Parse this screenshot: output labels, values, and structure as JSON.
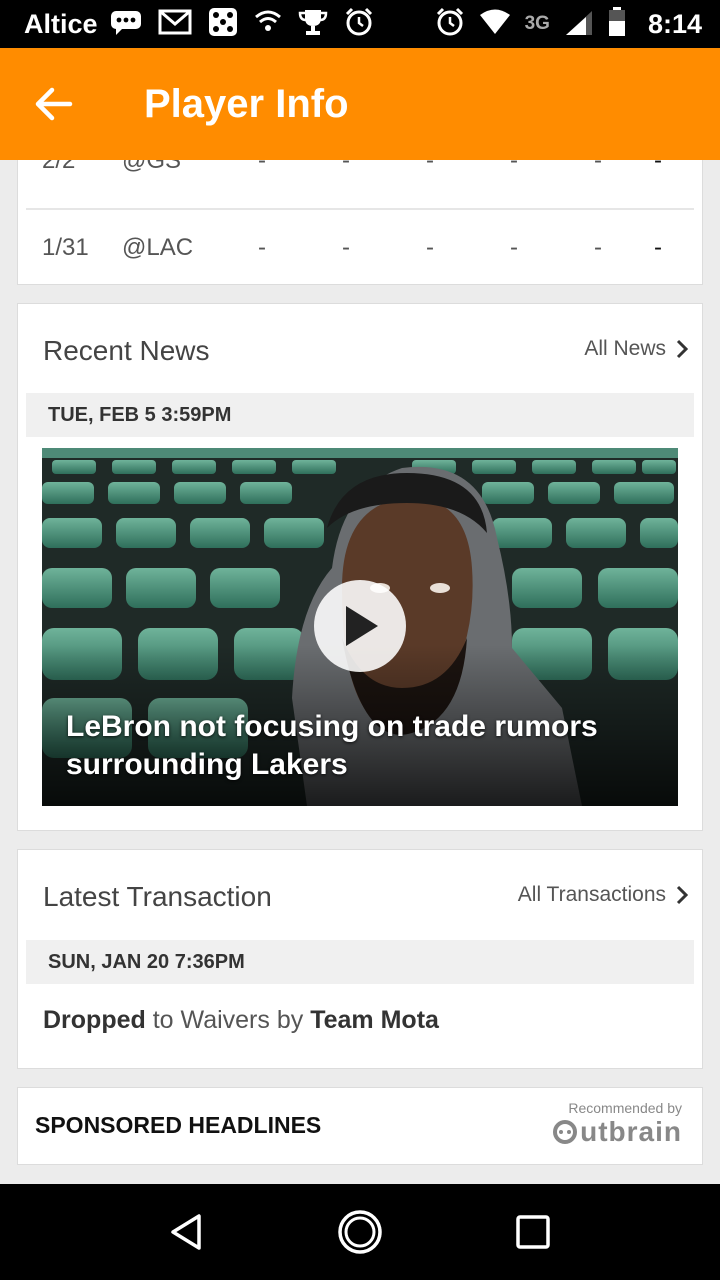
{
  "status_bar": {
    "carrier": "Altice",
    "network": "3G",
    "time": "8:14"
  },
  "app_bar": {
    "title": "Player Info",
    "back_icon": "arrow-left-icon"
  },
  "games": [
    {
      "date": "2/2",
      "opponent": "@GS",
      "stats": [
        "-",
        "-",
        "-",
        "-",
        "-",
        "-"
      ]
    },
    {
      "date": "1/31",
      "opponent": "@LAC",
      "stats": [
        "-",
        "-",
        "-",
        "-",
        "-",
        "-"
      ]
    }
  ],
  "news": {
    "heading": "Recent News",
    "all_link": "All News",
    "date": "TUE, FEB 5 3:59PM",
    "video_title": "LeBron not focusing on trade rumors surrounding Lakers"
  },
  "transaction": {
    "heading": "Latest Transaction",
    "all_link": "All Transactions",
    "date": "SUN, JAN 20 7:36PM",
    "action": "Dropped",
    "middle": "to Waivers by",
    "team": "Team Mota"
  },
  "sponsored": {
    "title": "SPONSORED HEADLINES",
    "recommended": "Recommended by",
    "brand": "utbrain"
  },
  "colors": {
    "accent": "#ff8c00"
  }
}
